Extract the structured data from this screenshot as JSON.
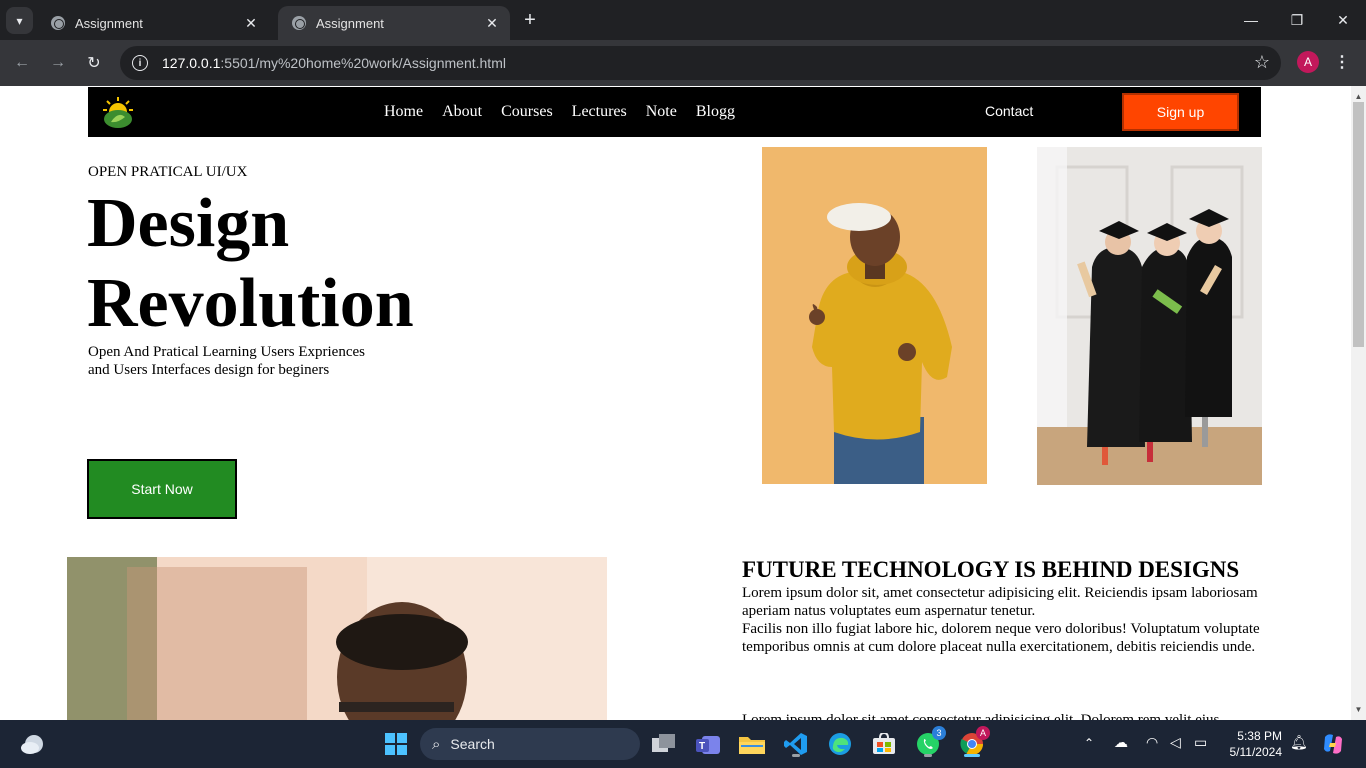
{
  "browser": {
    "tabs": [
      {
        "title": "Assignment",
        "active": false
      },
      {
        "title": "Assignment",
        "active": true
      }
    ],
    "new_tab": "+",
    "url_host": "127.0.0.1",
    "url_rest": ":5501/my%20home%20work/Assignment.html",
    "profile_initial": "A",
    "window_controls": {
      "minimize": "—",
      "restore": "❐",
      "close": "✕"
    }
  },
  "site": {
    "nav": {
      "links": [
        "Home",
        "About",
        "Courses",
        "Lectures",
        "Note",
        "Blogg"
      ],
      "contact": "Contact",
      "signup": "Sign up"
    },
    "hero": {
      "eyebrow": "OPEN PRATICAL UI/UX",
      "title_line1": "Design",
      "title_line2": "Revolution",
      "subtitle_line1": "Open And Pratical Learning Users Expriences",
      "subtitle_line2": "and Users Interfaces design for beginers",
      "cta": "Start Now"
    },
    "section": {
      "title": "FUTURE TECHNOLOGY IS BEHIND DESIGNS",
      "p1": "Lorem ipsum dolor sit, amet consectetur adipisicing elit. Reiciendis ipsam laboriosam aperiam natus voluptates eum aspernatur tenetur.",
      "p2": "Facilis non illo fugiat labore hic, dolorem neque vero doloribus! Voluptatum voluptate temporibus omnis at cum dolore placeat nulla exercitationem, debitis reiciendis unde.",
      "p3": "Lorem ipsum dolor sit amet consectetur adipisicing elit. Dolorem rem velit eius"
    },
    "colors": {
      "nav_bg": "#000000",
      "signup_bg": "#ff4500",
      "cta_bg": "#228b22"
    }
  },
  "taskbar": {
    "search_placeholder": "Search",
    "time": "5:38 PM",
    "date": "5/11/2024",
    "whatsapp_badge": "3",
    "chrome_badge": "A",
    "apps": [
      "windows-start-icon",
      "task-view-icon",
      "teams-icon",
      "file-explorer-icon",
      "vscode-icon",
      "edge-icon",
      "store-icon",
      "whatsapp-icon",
      "chrome-icon"
    ]
  }
}
